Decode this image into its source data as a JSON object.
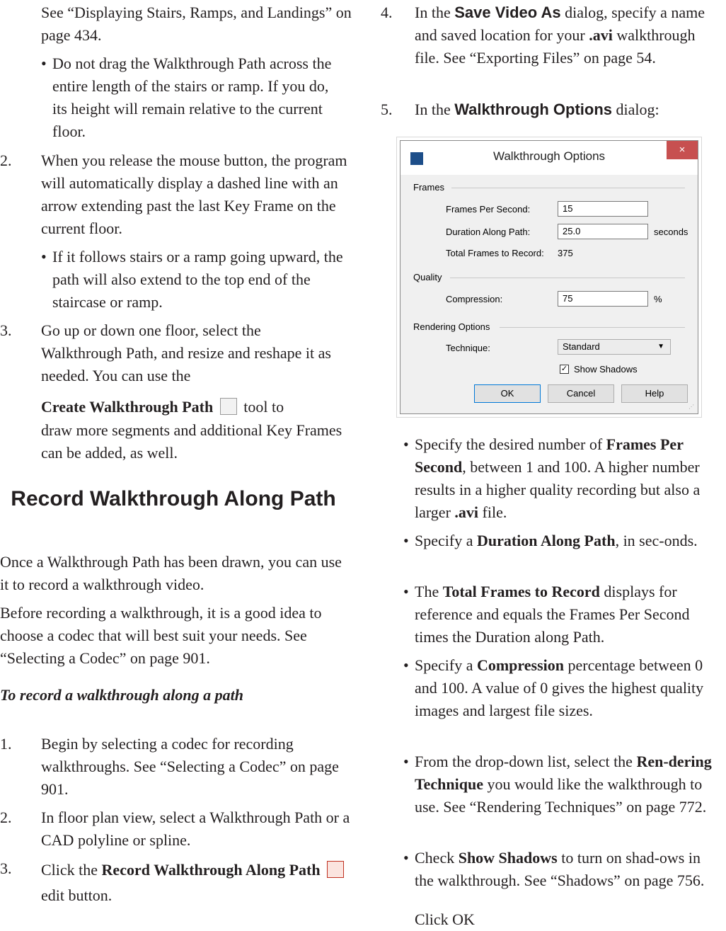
{
  "left": {
    "cont_ref": "See “Displaying Stairs, Ramps, and Landings” on page 434.",
    "bullet_drag": "Do not drag the Walkthrough Path across the entire length of the stairs or ramp. If you do, its height will remain relative to the current floor.",
    "step2_num": "2.",
    "step2": "When you  release the mouse button, the program will automatically display a dashed line with an arrow extending past the last Key Frame on the current floor.",
    "bullet_stairs": "If it follows stairs or a ramp going upward, the path will also extend to the top end of the staircase or ramp.",
    "step3_num": "3.",
    "step3": "Go up or down one floor, select the Walkthrough Path, and resize and reshape it as needed. You can use the",
    "step3_tool": "Create Walkthrough Path",
    "step3_tail1": "tool to",
    "step3_tail2": "draw more segments and additional Key Frames can be added, as well.",
    "heading": "Record Walkthrough Along Path",
    "para1": "Once a Walkthrough Path has been drawn, you can use it to record a walkthrough video.",
    "para2": "Before recording a walkthrough, it is a good idea to choose a codec that will best suit your needs. See “Selecting a Codec” on page 901.",
    "subheading": "To record a walkthrough along a path",
    "s1_num": "1.",
    "s1": "Begin by selecting a codec for recording walkthroughs. See “Selecting a Codec” on page 901.",
    "s2_num": "2.",
    "s2": "In floor plan view, select a Walkthrough Path or a CAD polyline or spline.",
    "s3_num": "3.",
    "s3_pre": "Click the",
    "s3_bold": "Record Walkthrough Along Path",
    "s3_post": "edit button."
  },
  "right": {
    "s4_num": "4.",
    "s4_pre": "In the",
    "s4_dialog": "Save Video As",
    "s4_mid": "dialog, specify a name and saved location for your",
    "s4_ext": ".avi",
    "s4_post": "walkthrough file. See “Exporting Files” on page 54.",
    "s5_num": "5.",
    "s5_pre": "In the",
    "s5_dialog": "Walkthrough Options",
    "s5_post": "dialog:",
    "b1_pre": "Specify the desired number of",
    "b1_bold": "Frames Per Second",
    "b1_mid": ", between 1 and 100. A higher number results in a higher quality recording but also a larger",
    "b1_ext": ".avi",
    "b1_post": "file.",
    "b2_pre": "Specify a",
    "b2_bold": "Duration Along Path",
    "b2_post": ", in sec-onds.",
    "b3_pre": "The",
    "b3_bold": "Total Frames to Record",
    "b3_post": "displays for reference and equals the Frames Per Second times the Duration along Path.",
    "b4_pre": "Specify a",
    "b4_bold": "Compression",
    "b4_post": "percentage between 0 and 100. A value of 0 gives the highest quality images and largest file sizes.",
    "b5_pre": "From the drop-down list, select the",
    "b5_bold": "Ren-dering Technique",
    "b5_post": "you would like the walkthrough to use. See “Rendering Techniques” on page 772.",
    "b6_pre": "Check",
    "b6_bold": "Show Shadows",
    "b6_post": "to turn on shad-ows in the walkthrough. See “Shadows” on page 756.",
    "b7_partial": "Click OK"
  },
  "dialog": {
    "title": "Walkthrough Options",
    "close": "×",
    "frames_group": "Frames",
    "fps_label": "Frames Per Second:",
    "fps_value": "15",
    "duration_label": "Duration Along Path:",
    "duration_value": "25.0",
    "duration_unit": "seconds",
    "total_label": "Total Frames to Record:",
    "total_value": "375",
    "quality_group": "Quality",
    "compression_label": "Compression:",
    "compression_value": "75",
    "compression_unit": "%",
    "render_group": "Rendering Options",
    "technique_label": "Technique:",
    "technique_value": "Standard",
    "shadows_label": "Show Shadows",
    "shadows_checked": true,
    "ok": "OK",
    "cancel": "Cancel",
    "help": "Help"
  }
}
